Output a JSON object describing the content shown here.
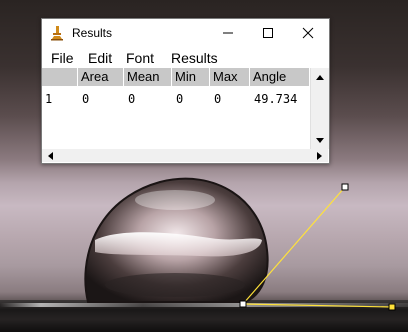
{
  "window": {
    "title": "Results",
    "app_icon": "microscope-icon",
    "controls": {
      "minimize": "—",
      "maximize": "☐",
      "close": "✕"
    }
  },
  "menu": [
    "File",
    "Edit",
    "Font",
    "Results"
  ],
  "table": {
    "columns": [
      "",
      "Area",
      "Mean",
      "Min",
      "Max",
      "Angle"
    ],
    "rows": [
      [
        "1",
        "0",
        "0",
        "0",
        "0",
        "49.734"
      ]
    ]
  },
  "scrollbars": {
    "vertical": [
      "up-arrow-icon",
      "down-arrow-icon"
    ],
    "horizontal": [
      "left-arrow-icon",
      "right-arrow-icon"
    ]
  },
  "overlay": {
    "angle_line_color": "#ffe23a",
    "handle_color": "#ffffff"
  }
}
